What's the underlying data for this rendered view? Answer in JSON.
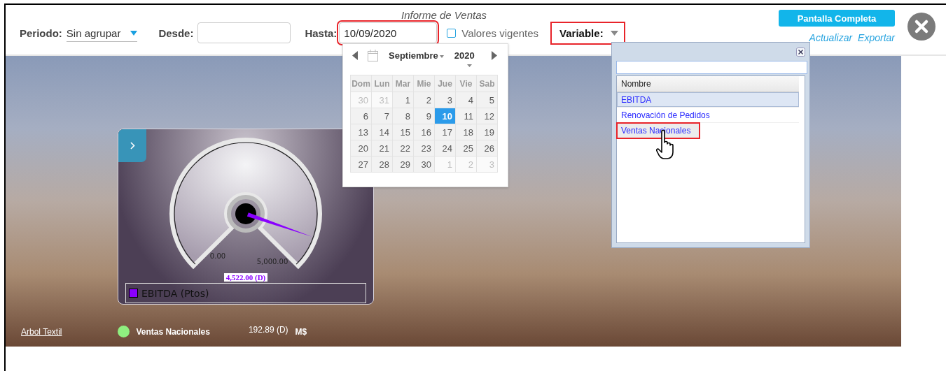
{
  "header": {
    "title": "Informe de Ventas"
  },
  "filters": {
    "period_label": "Periodo:",
    "period_value": "Sin agrupar",
    "from_label": "Desde:",
    "to_label": "Hasta:",
    "to_value": "10/09/2020",
    "to_highlighted": true,
    "current_values": {
      "label": "Valores vigentes",
      "checked": false
    },
    "variable": {
      "label": "Variable:",
      "highlighted": true
    }
  },
  "actions": {
    "fullscreen_button": "Pantalla Completa",
    "links": [
      "Actualizar",
      "Exportar"
    ]
  },
  "calendar": {
    "month": "Septiembre",
    "year": "2020",
    "weekdays": [
      "Dom",
      "Lun",
      "Mar",
      "Mie",
      "Jue",
      "Vie",
      "Sab"
    ],
    "weeks": [
      [
        {
          "day": "30",
          "outside": true,
          "selected": false
        },
        {
          "day": "31",
          "outside": true,
          "selected": false
        },
        {
          "day": "1",
          "outside": false,
          "selected": false
        },
        {
          "day": "2",
          "outside": false,
          "selected": false
        },
        {
          "day": "3",
          "outside": false,
          "selected": false
        },
        {
          "day": "4",
          "outside": false,
          "selected": false
        },
        {
          "day": "5",
          "outside": false,
          "selected": false
        }
      ],
      [
        {
          "day": "6",
          "outside": false,
          "selected": false
        },
        {
          "day": "7",
          "outside": false,
          "selected": false
        },
        {
          "day": "8",
          "outside": false,
          "selected": false
        },
        {
          "day": "9",
          "outside": false,
          "selected": false
        },
        {
          "day": "10",
          "outside": false,
          "selected": true
        },
        {
          "day": "11",
          "outside": false,
          "selected": false
        },
        {
          "day": "12",
          "outside": false,
          "selected": false
        }
      ],
      [
        {
          "day": "13",
          "outside": false,
          "selected": false
        },
        {
          "day": "14",
          "outside": false,
          "selected": false
        },
        {
          "day": "15",
          "outside": false,
          "selected": false
        },
        {
          "day": "16",
          "outside": false,
          "selected": false
        },
        {
          "day": "17",
          "outside": false,
          "selected": false
        },
        {
          "day": "18",
          "outside": false,
          "selected": false
        },
        {
          "day": "19",
          "outside": false,
          "selected": false
        }
      ],
      [
        {
          "day": "20",
          "outside": false,
          "selected": false
        },
        {
          "day": "21",
          "outside": false,
          "selected": false
        },
        {
          "day": "22",
          "outside": false,
          "selected": false
        },
        {
          "day": "23",
          "outside": false,
          "selected": false
        },
        {
          "day": "24",
          "outside": false,
          "selected": false
        },
        {
          "day": "25",
          "outside": false,
          "selected": false
        },
        {
          "day": "26",
          "outside": false,
          "selected": false
        }
      ],
      [
        {
          "day": "27",
          "outside": false,
          "selected": false
        },
        {
          "day": "28",
          "outside": false,
          "selected": false
        },
        {
          "day": "29",
          "outside": false,
          "selected": false
        },
        {
          "day": "30",
          "outside": false,
          "selected": false
        },
        {
          "day": "1",
          "outside": true,
          "selected": false
        },
        {
          "day": "2",
          "outside": true,
          "selected": false
        },
        {
          "day": "3",
          "outside": true,
          "selected": false
        }
      ]
    ]
  },
  "variable_picker": {
    "column": "Nombre",
    "items": [
      {
        "name": "EBITDA",
        "selected": true,
        "hovered": false,
        "highlighted": false
      },
      {
        "name": "Renovación de Pedidos",
        "selected": false,
        "hovered": false,
        "highlighted": false
      },
      {
        "name": "Ventas Nacionales",
        "selected": false,
        "hovered": true,
        "highlighted": true
      }
    ]
  },
  "gauge": {
    "min_label": "0.00",
    "max_label": "5,000.00",
    "level": 0.9044,
    "reading": "4,522.00 (D)",
    "legend": "EBITDA (Ptos)"
  },
  "footer": {
    "link": "Arbol Textil",
    "indicator": {
      "name": "Ventas Nacionales",
      "color": "#8fef7f",
      "value": "192.89 (D)",
      "unit": "M$"
    }
  }
}
